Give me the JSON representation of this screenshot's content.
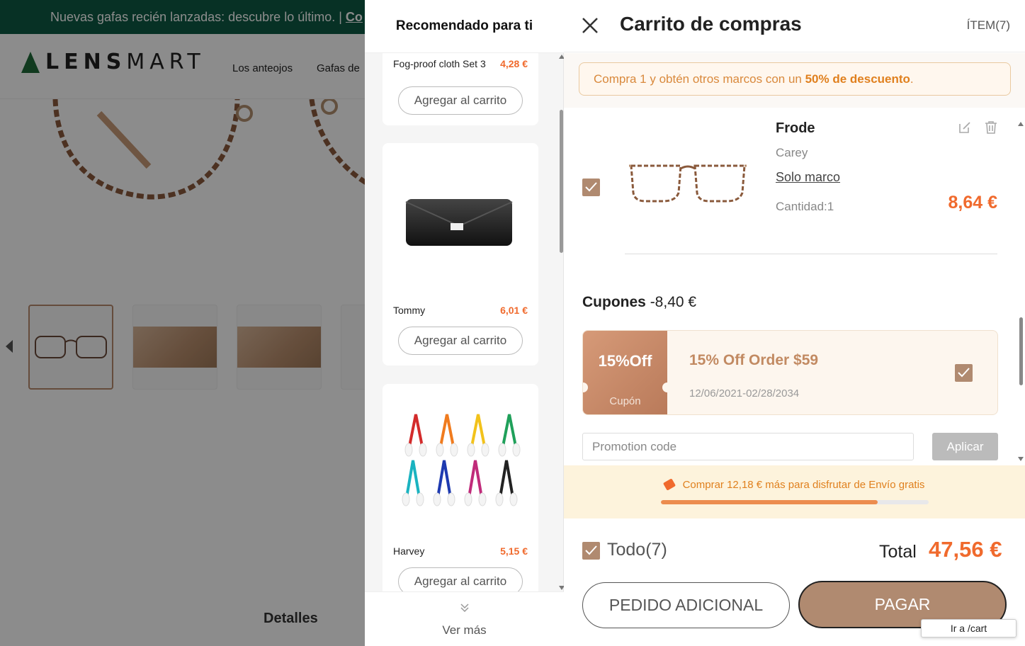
{
  "banner": {
    "text": "Nuevas gafas recién lanzadas: descubre lo último. | ",
    "link": "Co"
  },
  "header": {
    "logo_a": "LENS",
    "logo_b": "MART",
    "nav": [
      "Los anteojos",
      "Gafas de"
    ]
  },
  "background": {
    "details_label": "Detalles"
  },
  "recommendations": {
    "title": "Recomendado para ti",
    "items": [
      {
        "name": "Fog-proof cloth Set 3",
        "price": "4,28 €",
        "button": "Agregar al carrito"
      },
      {
        "name": "Tommy",
        "price": "6,01 €",
        "button": "Agregar al carrito"
      },
      {
        "name": "Harvey",
        "price": "5,15 €",
        "button": "Agregar al carrito"
      }
    ],
    "see_more": "Ver más"
  },
  "cart": {
    "title": "Carrito de compras",
    "items_count": "ÍTEM(7)",
    "promo": {
      "prefix": "Compra 1 y obtén otros marcos con un ",
      "highlight": "50% de descuento",
      "suffix": "."
    },
    "item": {
      "name": "Frode",
      "color": "Carey",
      "type": "Solo marco",
      "quantity": "Cantidad:1",
      "price": "8,64 €",
      "checked": true
    },
    "coupons": {
      "label": "Cupones",
      "amount": "-8,40 €",
      "coupon": {
        "badge": "15%Off",
        "badge_label": "Cupón",
        "title": "15% Off Order $59",
        "dates": "12/06/2021-02/28/2034",
        "checked": true
      },
      "input_placeholder": "Promotion code",
      "apply": "Aplicar"
    },
    "shipping": {
      "text": "Comprar 12,18 € más para disfrutar de Envío gratis",
      "progress": 0.81
    },
    "select_all": "Todo(7)",
    "total_label": "Total",
    "total_value": "47,56 €",
    "btn_additional": "PEDIDO ADICIONAL",
    "btn_pay": "PAGAR",
    "tooltip": "Ir a /cart"
  },
  "colors": {
    "accent": "#f06a2d",
    "brand": "#b08a70",
    "banner": "#0d5a44"
  }
}
